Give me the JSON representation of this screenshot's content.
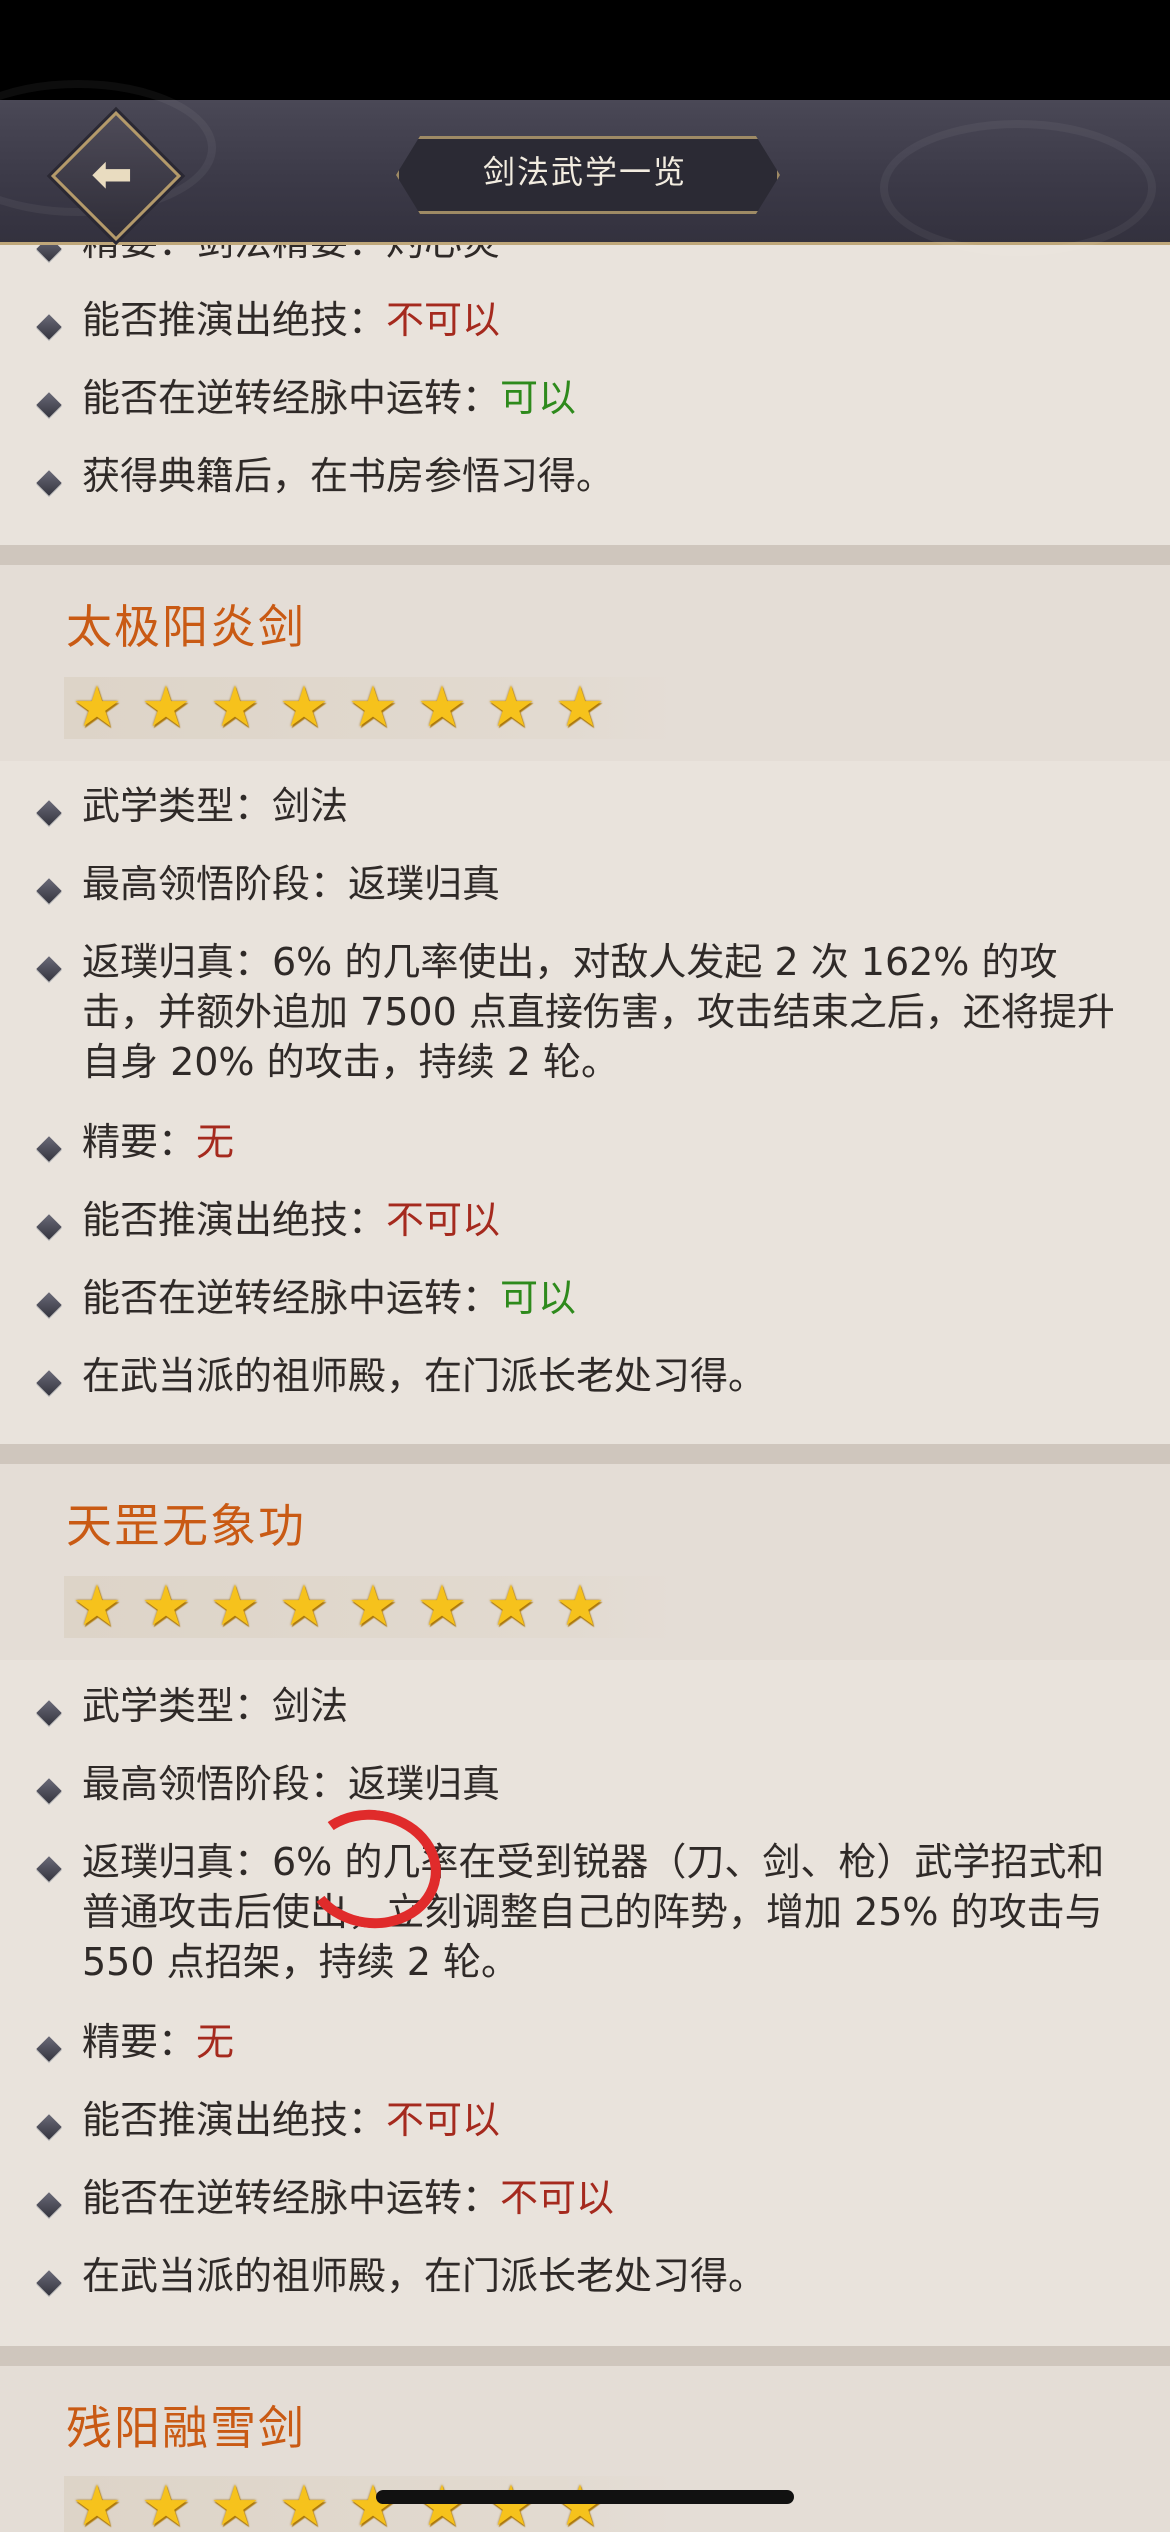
{
  "nav": {
    "title": "剑法武学一览",
    "back_icon": "back-arrow-icon"
  },
  "top_section": {
    "partial_line": "精要：剑法精要：灼心炎",
    "lines": [
      {
        "label": "能否推演出绝技：",
        "value": "不可以",
        "tone": "neg"
      },
      {
        "label": "能否在逆转经脉中运转：",
        "value": "可以",
        "tone": "pos"
      },
      {
        "label": "获得典籍后，在书房参悟习得。",
        "value": "",
        "tone": ""
      }
    ]
  },
  "skills": [
    {
      "name": "太极阳炎剑",
      "stars": 8,
      "lines": [
        {
          "label": "武学类型：",
          "value": "剑法",
          "tone": ""
        },
        {
          "label": "最高领悟阶段：",
          "value": "返璞归真",
          "tone": ""
        },
        {
          "label": "返璞归真：6% 的几率使出，对敌人发起 2 次 162% 的攻击，并额外追加 7500 点直接伤害，攻击结束之后，还将提升自身 20% 的攻击，持续 2 轮。",
          "value": "",
          "tone": ""
        },
        {
          "label": "精要：",
          "value": "无",
          "tone": "neg"
        },
        {
          "label": "能否推演出绝技：",
          "value": "不可以",
          "tone": "neg"
        },
        {
          "label": "能否在逆转经脉中运转：",
          "value": "可以",
          "tone": "pos"
        },
        {
          "label": "在武当派的祖师殿，在门派长老处习得。",
          "value": "",
          "tone": ""
        }
      ]
    },
    {
      "name": "天罡无象功",
      "stars": 8,
      "lines": [
        {
          "label": "武学类型：",
          "value": "剑法",
          "tone": ""
        },
        {
          "label": "最高领悟阶段：",
          "value": "返璞归真",
          "tone": ""
        },
        {
          "label": "返璞归真：6% 的几率在受到锐器（刀、剑、枪）武学招式和普通攻击后使出，立刻调整自己的阵势，增加 25% 的攻击与 550 点招架，持续 2 轮。",
          "value": "",
          "tone": ""
        },
        {
          "label": "精要：",
          "value": "无",
          "tone": "neg"
        },
        {
          "label": "能否推演出绝技：",
          "value": "不可以",
          "tone": "neg"
        },
        {
          "label": "能否在逆转经脉中运转：",
          "value": "不可以",
          "tone": "neg"
        },
        {
          "label": "在武当派的祖师殿，在门派长老处习得。",
          "value": "",
          "tone": ""
        }
      ]
    },
    {
      "name": "残阳融雪剑",
      "stars": 8,
      "lines": []
    }
  ],
  "colors": {
    "neg": "#a52a1e",
    "pos": "#2e8a1c",
    "title": "#c95a14",
    "annotation": "#e02b2b"
  }
}
